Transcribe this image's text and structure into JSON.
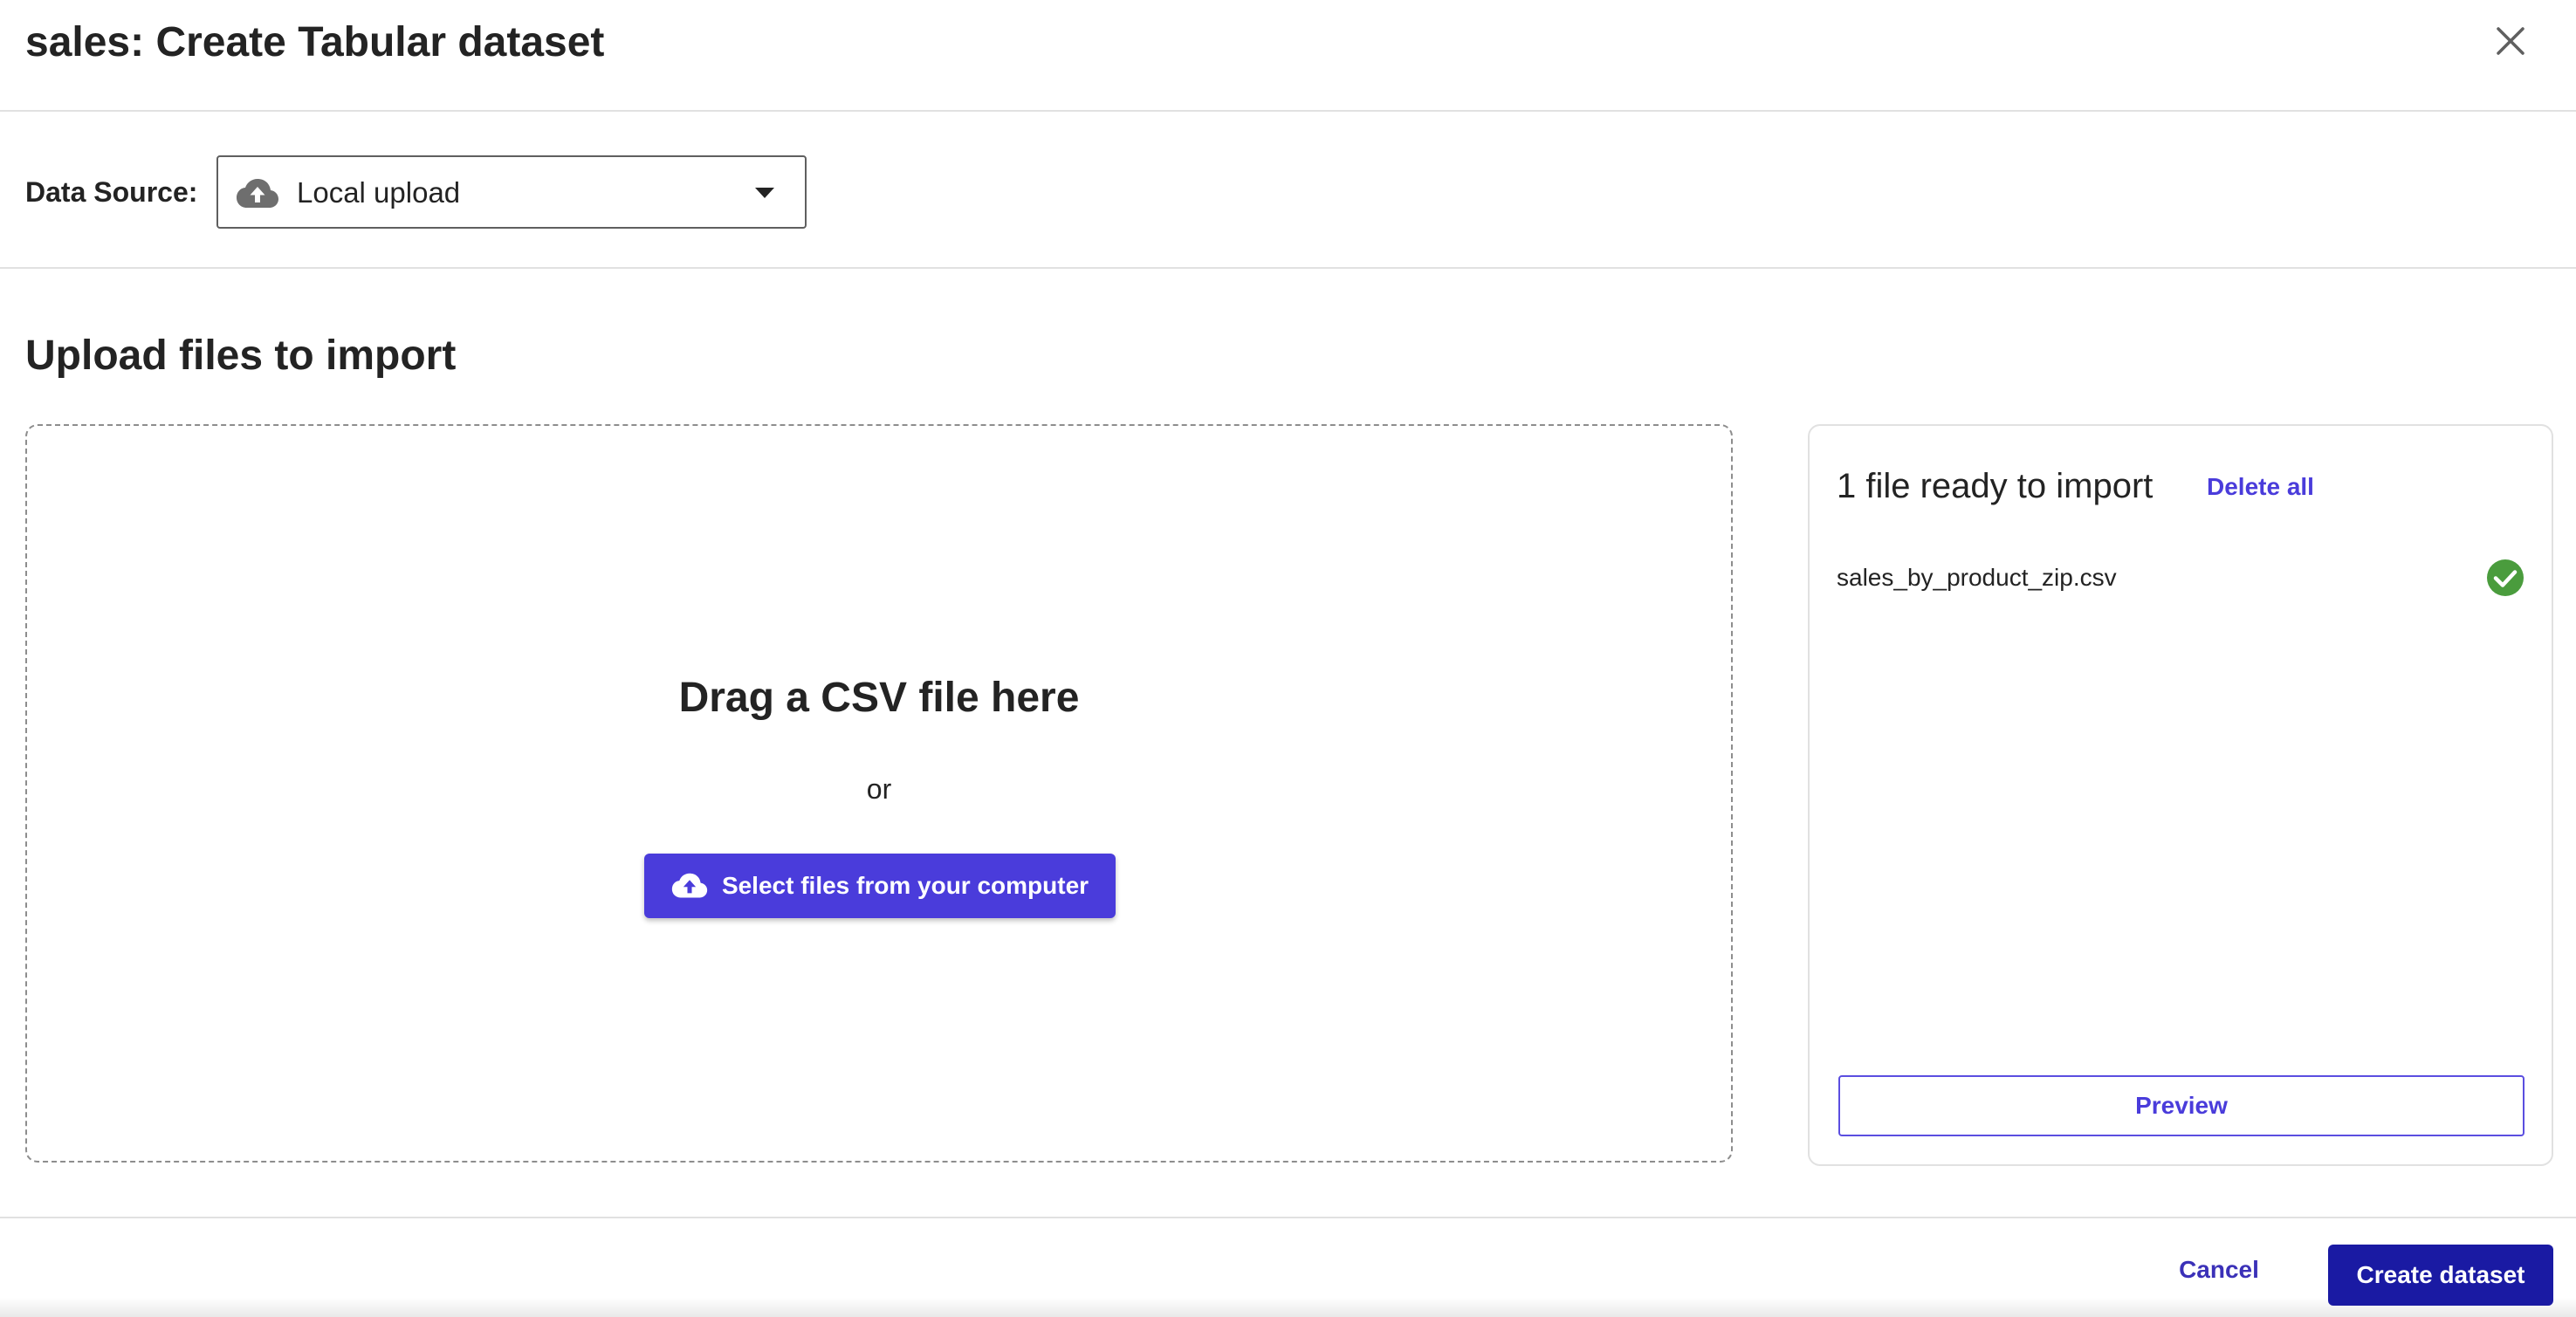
{
  "dialog": {
    "title": "sales: Create Tabular dataset",
    "close_icon": "close-icon"
  },
  "data_source": {
    "label": "Data Source:",
    "selected": "Local upload",
    "icon": "cloud-upload-icon"
  },
  "upload": {
    "section_title": "Upload files to import",
    "drop_title": "Drag a CSV file here",
    "or_text": "or",
    "select_button_label": "Select files from your computer"
  },
  "files_panel": {
    "title": "1 file ready to import",
    "delete_all_label": "Delete all",
    "files": [
      {
        "name": "sales_by_product_zip.csv",
        "status": "ready"
      }
    ],
    "preview_label": "Preview"
  },
  "footer": {
    "cancel_label": "Cancel",
    "create_label": "Create dataset"
  },
  "colors": {
    "accent": "#4a3cdb",
    "primary_button": "#1a1aa3",
    "success": "#4a9c3d",
    "text": "#232323",
    "border": "#e1e1e1"
  }
}
